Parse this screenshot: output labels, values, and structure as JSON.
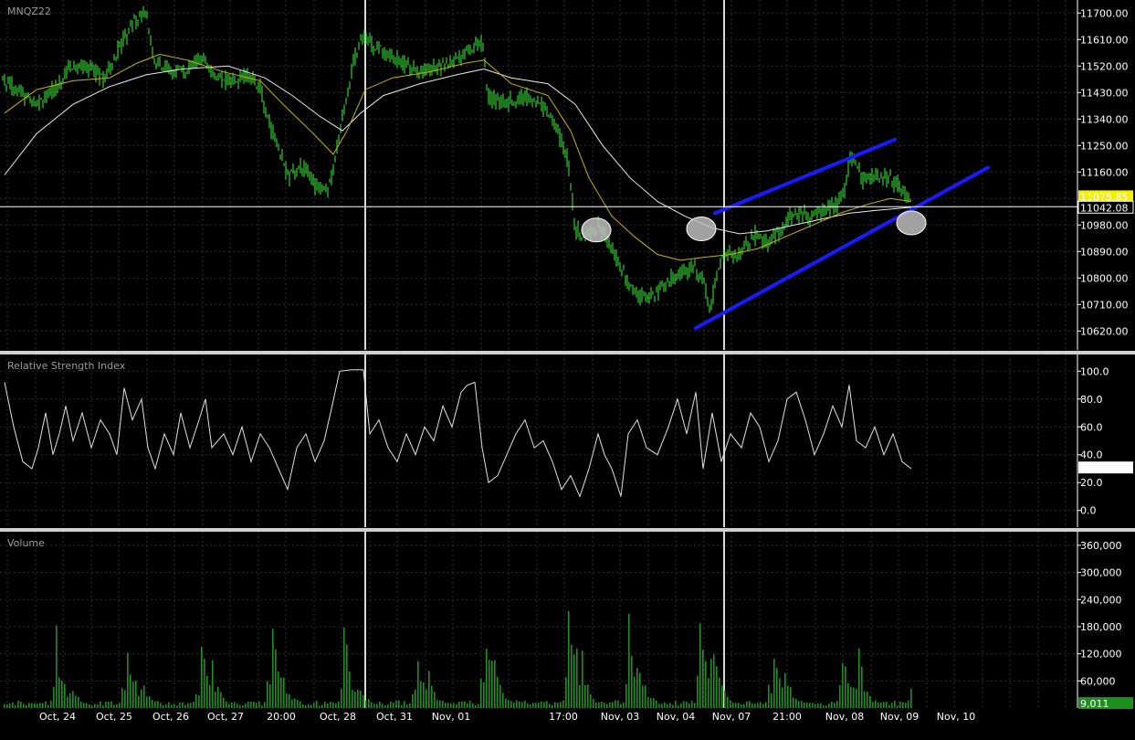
{
  "symbol": "MNQZ22",
  "colors": {
    "background": "#000000",
    "grid": "#2e2e2e",
    "candle": "#3cf23c",
    "ma_fast": "#c8b400",
    "ma_slow": "#e8e8e8",
    "rsi": "#e0e0e0",
    "volume": "#1e8f1e",
    "channel": "#1a1aff",
    "markers": "#bdbdbd",
    "last_price_bg": "#f4f000",
    "separator": "#d0d0d0"
  },
  "chart_data": [
    {
      "type": "line",
      "panel": "price",
      "title": "MNQZ22",
      "y_ticks": [
        10620,
        10710,
        10800,
        10890,
        10980,
        11070,
        11160,
        11250,
        11340,
        11430,
        11520,
        11610,
        11700
      ],
      "y_tick_labels": [
        "10620.00",
        "10710.00",
        "10800.00",
        "10890.00",
        "10980.00",
        "",
        "11160.00",
        "11250.00",
        "11340.00",
        "11430.00",
        "11520.00",
        "11610.00",
        "11700.00"
      ],
      "ylim": [
        10565,
        11735
      ],
      "crosshair_value": "11042.08",
      "last_value": "11075.85",
      "x_labels": [
        "Oct, 24",
        "Oct, 25",
        "Oct, 26",
        "Oct, 27",
        "20:00",
        "Oct, 28",
        "Oct, 31",
        "Nov, 01",
        "17:00",
        "Nov, 03",
        "Nov, 04",
        "Nov, 07",
        "21:00",
        "Nov, 08",
        "Nov, 09",
        "Nov, 10"
      ],
      "price_anchors": [
        [
          0,
          11480
        ],
        [
          20,
          11440
        ],
        [
          40,
          11380
        ],
        [
          60,
          11450
        ],
        [
          80,
          11530
        ],
        [
          100,
          11510
        ],
        [
          115,
          11480
        ],
        [
          130,
          11580
        ],
        [
          145,
          11660
        ],
        [
          160,
          11700
        ],
        [
          170,
          11520
        ],
        [
          185,
          11510
        ],
        [
          205,
          11500
        ],
        [
          220,
          11560
        ],
        [
          235,
          11490
        ],
        [
          255,
          11470
        ],
        [
          270,
          11490
        ],
        [
          285,
          11450
        ],
        [
          295,
          11320
        ],
        [
          305,
          11240
        ],
        [
          315,
          11140
        ],
        [
          330,
          11180
        ],
        [
          345,
          11120
        ],
        [
          360,
          11100
        ],
        [
          372,
          11300
        ],
        [
          385,
          11500
        ],
        [
          395,
          11620
        ],
        [
          410,
          11590
        ],
        [
          425,
          11560
        ],
        [
          440,
          11530
        ],
        [
          455,
          11500
        ],
        [
          470,
          11510
        ],
        [
          485,
          11520
        ],
        [
          500,
          11540
        ],
        [
          515,
          11580
        ],
        [
          528,
          11600
        ],
        [
          535,
          11420
        ],
        [
          550,
          11390
        ],
        [
          565,
          11410
        ],
        [
          580,
          11420
        ],
        [
          595,
          11380
        ],
        [
          610,
          11310
        ],
        [
          622,
          11200
        ],
        [
          630,
          10960
        ],
        [
          640,
          10940
        ],
        [
          655,
          10970
        ],
        [
          668,
          10920
        ],
        [
          680,
          10830
        ],
        [
          690,
          10770
        ],
        [
          705,
          10730
        ],
        [
          720,
          10750
        ],
        [
          735,
          10800
        ],
        [
          748,
          10820
        ],
        [
          760,
          10840
        ],
        [
          770,
          10800
        ],
        [
          778,
          10690
        ],
        [
          786,
          10830
        ],
        [
          795,
          10880
        ],
        [
          810,
          10870
        ],
        [
          825,
          10950
        ],
        [
          840,
          10920
        ],
        [
          855,
          10960
        ],
        [
          870,
          11030
        ],
        [
          885,
          11010
        ],
        [
          900,
          11030
        ],
        [
          915,
          11040
        ],
        [
          925,
          11100
        ],
        [
          932,
          11220
        ],
        [
          945,
          11130
        ],
        [
          960,
          11150
        ],
        [
          975,
          11140
        ],
        [
          990,
          11090
        ],
        [
          998,
          11060
        ]
      ],
      "ma_fast_anchors": [
        [
          5,
          11360
        ],
        [
          40,
          11440
        ],
        [
          80,
          11470
        ],
        [
          120,
          11480
        ],
        [
          150,
          11530
        ],
        [
          175,
          11560
        ],
        [
          205,
          11540
        ],
        [
          245,
          11500
        ],
        [
          285,
          11470
        ],
        [
          310,
          11390
        ],
        [
          340,
          11300
        ],
        [
          365,
          11220
        ],
        [
          380,
          11300
        ],
        [
          400,
          11440
        ],
        [
          430,
          11480
        ],
        [
          470,
          11500
        ],
        [
          510,
          11530
        ],
        [
          530,
          11540
        ],
        [
          560,
          11460
        ],
        [
          600,
          11420
        ],
        [
          625,
          11300
        ],
        [
          645,
          11140
        ],
        [
          670,
          11010
        ],
        [
          695,
          10940
        ],
        [
          720,
          10880
        ],
        [
          745,
          10860
        ],
        [
          770,
          10870
        ],
        [
          800,
          10880
        ],
        [
          830,
          10900
        ],
        [
          860,
          10940
        ],
        [
          890,
          10980
        ],
        [
          920,
          11020
        ],
        [
          950,
          11050
        ],
        [
          975,
          11070
        ],
        [
          998,
          11060
        ]
      ],
      "ma_slow_anchors": [
        [
          5,
          11150
        ],
        [
          40,
          11290
        ],
        [
          80,
          11390
        ],
        [
          120,
          11450
        ],
        [
          160,
          11490
        ],
        [
          200,
          11510
        ],
        [
          250,
          11520
        ],
        [
          290,
          11480
        ],
        [
          320,
          11420
        ],
        [
          350,
          11350
        ],
        [
          375,
          11300
        ],
        [
          395,
          11360
        ],
        [
          420,
          11420
        ],
        [
          460,
          11460
        ],
        [
          500,
          11490
        ],
        [
          530,
          11510
        ],
        [
          560,
          11480
        ],
        [
          600,
          11460
        ],
        [
          630,
          11390
        ],
        [
          660,
          11250
        ],
        [
          690,
          11140
        ],
        [
          720,
          11060
        ],
        [
          750,
          11010
        ],
        [
          780,
          10970
        ],
        [
          810,
          10950
        ],
        [
          840,
          10960
        ],
        [
          870,
          10980
        ],
        [
          900,
          11000
        ],
        [
          930,
          11020
        ],
        [
          960,
          11030
        ],
        [
          998,
          11040
        ]
      ],
      "trend_lines": [
        [
          [
            783,
            11020
          ],
          [
            980,
            11270
          ]
        ],
        [
          [
            762,
            10630
          ],
          [
            1082,
            11175
          ]
        ]
      ],
      "markers": [
        [
          653,
          10963
        ],
        [
          768,
          10967
        ],
        [
          998,
          10987
        ]
      ],
      "vertical_lines": [
        400,
        793
      ]
    },
    {
      "type": "line",
      "panel": "rsi",
      "title": "Relative Strength Index",
      "y_ticks": [
        0,
        20,
        40,
        60,
        80,
        100
      ],
      "y_tick_labels": [
        "0.0",
        "20.0",
        "40.0",
        "60.0",
        "80.0",
        "100.0"
      ],
      "ylim": [
        -12,
        112
      ],
      "last_value": "30.5",
      "rsi_anchors": [
        [
          5,
          92
        ],
        [
          15,
          60
        ],
        [
          25,
          35
        ],
        [
          35,
          30
        ],
        [
          42,
          45
        ],
        [
          50,
          70
        ],
        [
          58,
          40
        ],
        [
          65,
          55
        ],
        [
          72,
          75
        ],
        [
          80,
          50
        ],
        [
          90,
          70
        ],
        [
          100,
          45
        ],
        [
          110,
          65
        ],
        [
          120,
          55
        ],
        [
          128,
          40
        ],
        [
          136,
          88
        ],
        [
          145,
          65
        ],
        [
          155,
          80
        ],
        [
          162,
          45
        ],
        [
          170,
          30
        ],
        [
          180,
          55
        ],
        [
          190,
          40
        ],
        [
          198,
          70
        ],
        [
          208,
          45
        ],
        [
          218,
          65
        ],
        [
          225,
          80
        ],
        [
          232,
          45
        ],
        [
          245,
          55
        ],
        [
          255,
          40
        ],
        [
          265,
          60
        ],
        [
          275,
          35
        ],
        [
          285,
          55
        ],
        [
          295,
          45
        ],
        [
          305,
          30
        ],
        [
          315,
          15
        ],
        [
          325,
          45
        ],
        [
          335,
          55
        ],
        [
          345,
          35
        ],
        [
          355,
          50
        ],
        [
          362,
          70
        ],
        [
          372,
          100
        ],
        [
          385,
          101
        ],
        [
          398,
          101
        ],
        [
          405,
          55
        ],
        [
          415,
          65
        ],
        [
          425,
          45
        ],
        [
          435,
          35
        ],
        [
          445,
          55
        ],
        [
          455,
          40
        ],
        [
          465,
          60
        ],
        [
          475,
          50
        ],
        [
          485,
          75
        ],
        [
          495,
          60
        ],
        [
          505,
          85
        ],
        [
          512,
          90
        ],
        [
          520,
          92
        ],
        [
          528,
          45
        ],
        [
          535,
          20
        ],
        [
          545,
          25
        ],
        [
          555,
          40
        ],
        [
          565,
          55
        ],
        [
          575,
          65
        ],
        [
          585,
          45
        ],
        [
          595,
          50
        ],
        [
          605,
          35
        ],
        [
          615,
          15
        ],
        [
          625,
          25
        ],
        [
          635,
          10
        ],
        [
          645,
          30
        ],
        [
          655,
          55
        ],
        [
          662,
          40
        ],
        [
          670,
          30
        ],
        [
          680,
          10
        ],
        [
          688,
          55
        ],
        [
          698,
          65
        ],
        [
          708,
          45
        ],
        [
          720,
          40
        ],
        [
          732,
          60
        ],
        [
          742,
          80
        ],
        [
          752,
          55
        ],
        [
          762,
          85
        ],
        [
          770,
          30
        ],
        [
          780,
          70
        ],
        [
          790,
          35
        ],
        [
          800,
          55
        ],
        [
          812,
          45
        ],
        [
          822,
          70
        ],
        [
          832,
          60
        ],
        [
          842,
          35
        ],
        [
          852,
          50
        ],
        [
          862,
          80
        ],
        [
          872,
          85
        ],
        [
          882,
          65
        ],
        [
          892,
          40
        ],
        [
          902,
          55
        ],
        [
          912,
          75
        ],
        [
          922,
          60
        ],
        [
          930,
          90
        ],
        [
          938,
          50
        ],
        [
          948,
          45
        ],
        [
          958,
          60
        ],
        [
          968,
          40
        ],
        [
          978,
          55
        ],
        [
          988,
          35
        ],
        [
          998,
          30
        ]
      ],
      "vertical_lines": [
        400,
        793
      ]
    },
    {
      "type": "bar",
      "panel": "volume",
      "title": "Volume",
      "y_ticks": [
        60000,
        120000,
        180000,
        240000,
        300000,
        360000
      ],
      "y_tick_labels": [
        "60,000",
        "120,000",
        "180,000",
        "240,000",
        "300,000",
        "360,000"
      ],
      "ylim": [
        0,
        380000
      ],
      "last_value": "9,011",
      "spikes": [
        [
          60,
          235000
        ],
        [
          75,
          80000
        ],
        [
          137,
          220000
        ],
        [
          152,
          90000
        ],
        [
          218,
          200000
        ],
        [
          232,
          110000
        ],
        [
          296,
          240000
        ],
        [
          308,
          120000
        ],
        [
          375,
          230000
        ],
        [
          390,
          90000
        ],
        [
          455,
          145000
        ],
        [
          468,
          100000
        ],
        [
          530,
          310000
        ],
        [
          540,
          155000
        ],
        [
          622,
          365000
        ],
        [
          635,
          160000
        ],
        [
          688,
          255000
        ],
        [
          698,
          160000
        ],
        [
          765,
          280000
        ],
        [
          778,
          215000
        ],
        [
          845,
          200000
        ],
        [
          858,
          110000
        ],
        [
          922,
          180000
        ],
        [
          938,
          170000
        ],
        [
          995,
          65000
        ]
      ],
      "vertical_lines": [
        400,
        793
      ]
    }
  ]
}
